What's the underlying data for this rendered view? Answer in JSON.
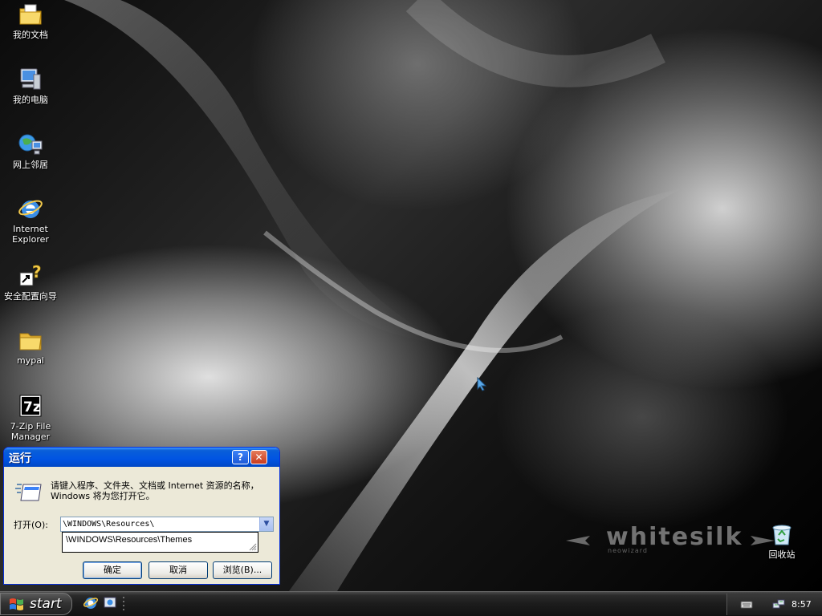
{
  "desktop": {
    "icons": [
      {
        "label": "我的文档",
        "icon": "my-documents-folder-icon"
      },
      {
        "label": "我的电脑",
        "icon": "my-computer-icon"
      },
      {
        "label": "网上邻居",
        "icon": "network-places-icon"
      },
      {
        "label": "Internet\nExplorer",
        "icon": "internet-explorer-icon"
      },
      {
        "label": "安全配置向导",
        "icon": "security-wizard-icon"
      },
      {
        "label": "mypal",
        "icon": "folder-icon"
      },
      {
        "label": "7-Zip File\nManager",
        "icon": "7zip-icon"
      },
      {
        "label": "回收站",
        "icon": "recycle-bin-icon"
      }
    ],
    "logo": {
      "text": "whitesilk",
      "subtext": "neowizard"
    }
  },
  "run_dialog": {
    "title": "运行",
    "description": "请键入程序、文件夹、文档或 Internet 资源的名称，Windows 将为您打开它。",
    "open_label": "打开(O):",
    "input_value": "\\WINDOWS\\Resources\\",
    "suggestion": "\\WINDOWS\\Resources\\Themes",
    "ok_label": "确定",
    "cancel_label": "取消",
    "browse_label": "浏览(B)...",
    "help_glyph": "?",
    "close_glyph": "✕"
  },
  "taskbar": {
    "start_label": "start",
    "clock": "8:57"
  },
  "colors": {
    "titlebar": "#0054E3",
    "dialog_bg": "#ECE9D8",
    "taskbar": "#1C1C1C"
  }
}
